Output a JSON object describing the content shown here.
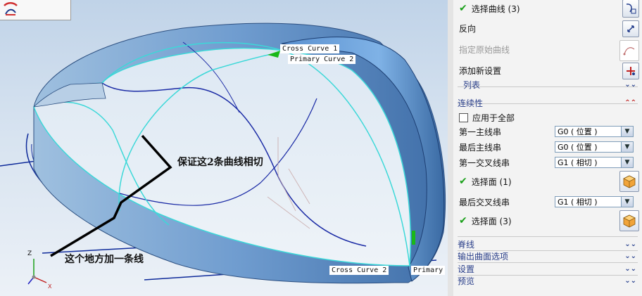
{
  "viewport": {
    "labels": {
      "cross_curve_1": "Cross Curve  1",
      "primary_curve_2": "Primary Curve  2",
      "cross_curve_2": "Cross Curve  2",
      "primary": "Primary"
    },
    "annotations": {
      "tangent_note": "保证这2条曲线相切",
      "add_curve_note": "这个地方加一条线"
    },
    "axes": {
      "z": "Z",
      "x": "X"
    }
  },
  "panel": {
    "select_curve": "选择曲线 (3)",
    "reverse": "反向",
    "specify_origin_curve": "指定原始曲线",
    "add_new_set": "添加新设置",
    "list": "列表",
    "continuity": {
      "header": "连续性",
      "apply_all": "应用于全部",
      "first_primary_label": "第一主线串",
      "first_primary_value": "G0 ( 位置 )",
      "last_primary_label": "最后主线串",
      "last_primary_value": "G0 ( 位置 )",
      "first_cross_label": "第一交叉线串",
      "first_cross_value": "G1 ( 相切 )",
      "select_face_1": "选择面 (1)",
      "last_cross_label": "最后交叉线串",
      "last_cross_value": "G1 ( 相切 )",
      "select_face_3": "选择面 (3)"
    },
    "sections": {
      "spine": "脊线",
      "output_surface_options": "输出曲面选项",
      "settings": "设置",
      "preview": "预览"
    },
    "colors": {
      "check": "#1aa01a",
      "section_text": "#2a3f8a"
    }
  }
}
